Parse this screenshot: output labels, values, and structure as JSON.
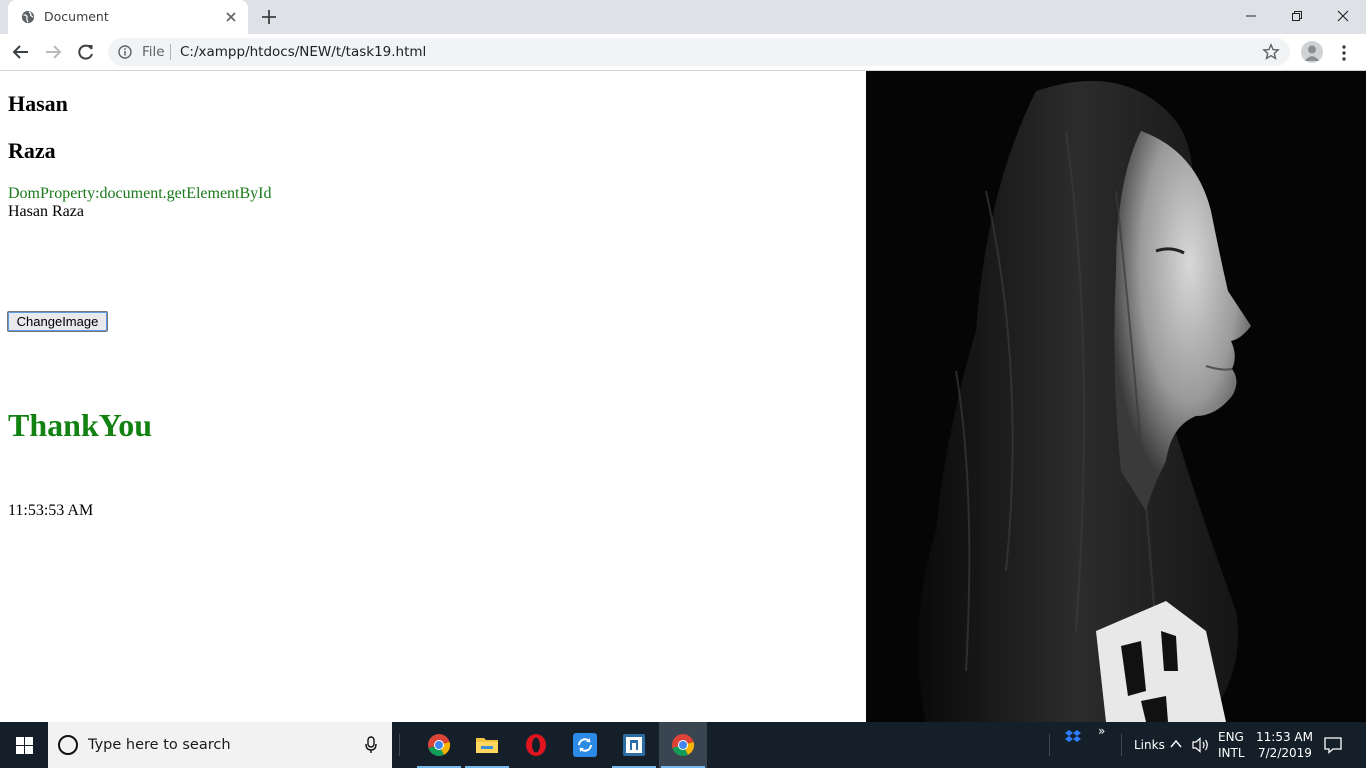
{
  "browser": {
    "tab_title": "Document",
    "url_scheme": "File",
    "url": "C:/xampp/htdocs/NEW/t/task19.html",
    "icons": [
      "globe-icon",
      "close-icon",
      "plus-icon",
      "minimize-icon",
      "restore-icon",
      "window-close-icon",
      "back-icon",
      "forward-icon",
      "reload-icon",
      "info-icon",
      "star-icon",
      "profile-icon",
      "more-icon"
    ]
  },
  "page": {
    "first_name": "Hasan",
    "last_name": "Raza",
    "dom_property": "DomProperty:document.getElementById",
    "full_name": "Hasan Raza",
    "button_label": "ChangeImage",
    "thanks": "ThankYou",
    "time": "11:53:53 AM",
    "image": "black-and-white profile photo of woman with long hair"
  },
  "taskbar": {
    "search_placeholder": "Type here to search",
    "apps": [
      "chrome-icon",
      "file-explorer-icon",
      "opera-icon",
      "sync-app-icon",
      "app-window-icon",
      "chrome-icon"
    ],
    "tray_links": "Links",
    "lang_top": "ENG",
    "lang_bottom": "INTL",
    "clock_time": "11:53 AM",
    "clock_date": "7/2/2019",
    "chevron": "»"
  },
  "colors": {
    "green_text": "#1a7a1a",
    "thanks_green": "#128212",
    "taskbar": "#151f2a",
    "tabstrip": "#dee1e6"
  }
}
